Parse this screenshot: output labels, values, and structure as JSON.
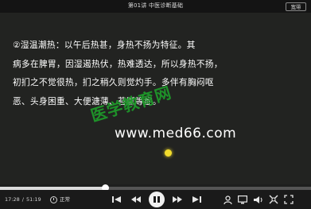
{
  "window": {
    "title": "第01讲   中医诊断基础",
    "quality_label": "宽带"
  },
  "slide": {
    "lines": [
      "②湿温潮热：以午后热甚，身热不扬为特征。其",
      "病多在脾胃，因湿遏热伏，热难透达，所以身热不扬，",
      "初扪之不觉很热，扪之稍久则觉灼手。多伴有胸闷呕",
      "恶、头身困重、大便溏薄、苔腻等症。"
    ],
    "watermark_cn": "医学教育网",
    "watermark_url": "www.med66.com"
  },
  "playback": {
    "current_time": "17:28",
    "total_time": "51:19",
    "progress": 0.34,
    "speed_label": "正常"
  },
  "icons": {
    "rewind": "skip-back-icon",
    "previous": "previous-icon",
    "pause": "pause-icon",
    "next": "next-icon",
    "forward": "skip-forward-icon",
    "user": "user-icon",
    "screen": "screen-icon",
    "volume": "volume-icon",
    "settings": "settings-icon",
    "fullscreen": "fullscreen-icon"
  },
  "colors": {
    "watermark_green": "#1e9b2a",
    "cursor_yellow": "#f2dc2c"
  }
}
